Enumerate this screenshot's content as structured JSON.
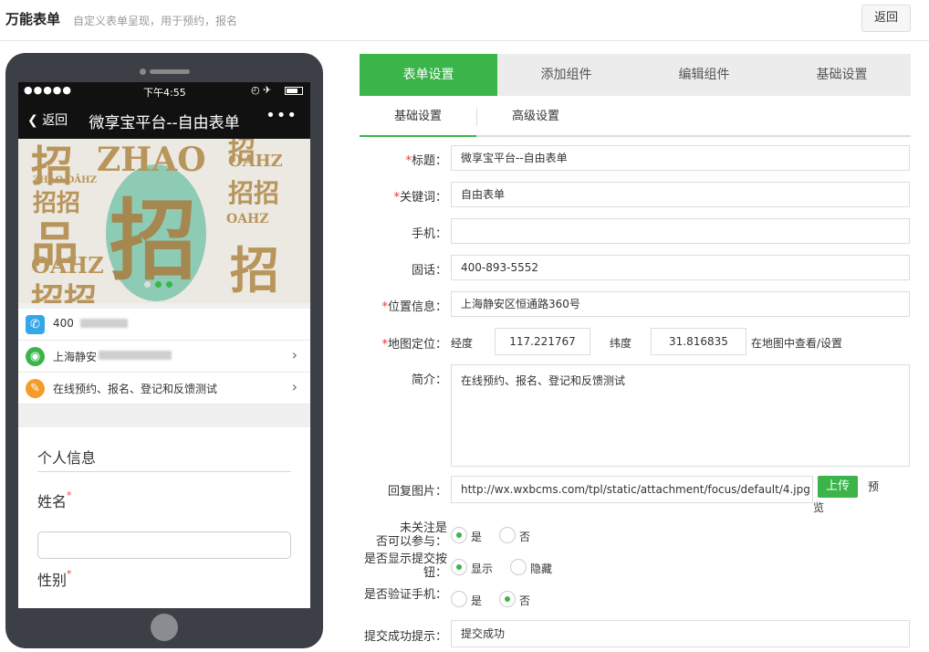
{
  "header": {
    "title": "万能表单",
    "subtitle": "自定义表单呈现，用于预约，报名",
    "back_label": "返回"
  },
  "phone": {
    "status": {
      "dots": "●●●●●",
      "time": "下午4:55",
      "icons": "◴ ✈"
    },
    "nav": {
      "back": "返回",
      "title": "微享宝平台--自由表单",
      "more": "•••"
    },
    "banner": {
      "word1": "招",
      "word2": "ZHAO",
      "word3": "OAHZ",
      "word4": "招",
      "word5": "ZHĀO OĀHZ",
      "word6": "招招",
      "word7": "品"
    },
    "rows": [
      {
        "icon": "✆",
        "text": "400",
        "color": "#35a7e8"
      },
      {
        "icon": "◉",
        "text": "上海静安",
        "color": "#3bb44a"
      },
      {
        "icon": "✎",
        "text": "在线预约、报名、登记和反馈测试",
        "color": "#f39c2b"
      }
    ],
    "section_title": "个人信息",
    "field1_label": "姓名",
    "field2_label": "性别",
    "required_mark": "*"
  },
  "tabs": [
    "表单设置",
    "添加组件",
    "编辑组件",
    "基础设置"
  ],
  "subtabs": [
    "基础设置",
    "高级设置"
  ],
  "form": {
    "title_label": "标题：",
    "title_value": "微享宝平台--自由表单",
    "keyword_label": "关键词：",
    "keyword_value": "自由表单",
    "mobile_label": "手机：",
    "mobile_value": "",
    "phone_label": "固话：",
    "phone_value": "400-893-5552",
    "location_label": "位置信息：",
    "location_value": "上海静安区恒通路360号",
    "map_label": "地图定位：",
    "lng_label": "经度",
    "lng_value": "117.221767",
    "lat_label": "纬度",
    "lat_value": "31.816835",
    "map_link": "在地图中查看/设置",
    "intro_label": "简介：",
    "intro_value": "在线预约、报名、登记和反馈测试",
    "image_label": "回复图片：",
    "image_value": "http://wx.wxbcms.com/tpl/static/attachment/focus/default/4.jpg",
    "upload_label": "上传",
    "preview_label1": "预",
    "preview_label2": "览",
    "unfollow_label1": "未关注是",
    "unfollow_label2": "否可以参与：",
    "show_submit_label1": "是否显示提交按",
    "show_submit_label2": "钮：",
    "verify_label": "是否验证手机：",
    "yes": "是",
    "no": "否",
    "show": "显示",
    "hide": "隐藏",
    "success_label": "提交成功提示：",
    "success_value": "提交成功",
    "required_mark": "*"
  }
}
